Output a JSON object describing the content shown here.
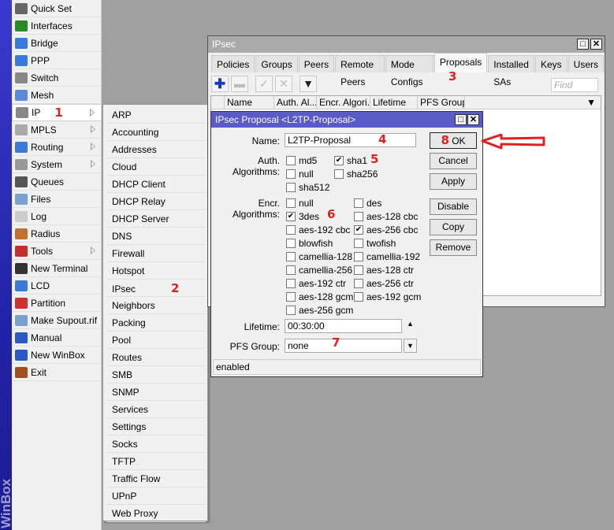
{
  "brand": "WinBox",
  "sidebar": {
    "items": [
      {
        "label": "Quick Set",
        "icon": "quick-set-icon",
        "color": "#666",
        "submenu": false
      },
      {
        "label": "Interfaces",
        "icon": "interfaces-icon",
        "color": "#2a8a2a",
        "submenu": false
      },
      {
        "label": "Bridge",
        "icon": "bridge-icon",
        "color": "#3a7ad8",
        "submenu": false
      },
      {
        "label": "PPP",
        "icon": "ppp-icon",
        "color": "#3a7ad8",
        "submenu": false
      },
      {
        "label": "Switch",
        "icon": "switch-icon",
        "color": "#888",
        "submenu": false
      },
      {
        "label": "Mesh",
        "icon": "mesh-icon",
        "color": "#5a8ad8",
        "submenu": false
      },
      {
        "label": "IP",
        "icon": "ip-icon",
        "color": "#888",
        "submenu": true,
        "active": true,
        "marker": "1"
      },
      {
        "label": "MPLS",
        "icon": "mpls-icon",
        "color": "#aaa",
        "submenu": true
      },
      {
        "label": "Routing",
        "icon": "routing-icon",
        "color": "#3a7ad8",
        "submenu": true
      },
      {
        "label": "System",
        "icon": "system-icon",
        "color": "#999",
        "submenu": true
      },
      {
        "label": "Queues",
        "icon": "queues-icon",
        "color": "#555",
        "submenu": false
      },
      {
        "label": "Files",
        "icon": "files-icon",
        "color": "#7aa0d0",
        "submenu": false
      },
      {
        "label": "Log",
        "icon": "log-icon",
        "color": "#ccc",
        "submenu": false
      },
      {
        "label": "Radius",
        "icon": "radius-icon",
        "color": "#c07030",
        "submenu": false
      },
      {
        "label": "Tools",
        "icon": "tools-icon",
        "color": "#c03030",
        "submenu": true
      },
      {
        "label": "New Terminal",
        "icon": "terminal-icon",
        "color": "#333",
        "submenu": false
      },
      {
        "label": "LCD",
        "icon": "lcd-icon",
        "color": "#3a7ad8",
        "submenu": false
      },
      {
        "label": "Partition",
        "icon": "partition-icon",
        "color": "#d03030",
        "submenu": false
      },
      {
        "label": "Make Supout.rif",
        "icon": "supout-icon",
        "color": "#7aa0d0",
        "submenu": false
      },
      {
        "label": "Manual",
        "icon": "manual-icon",
        "color": "#2a5ac8",
        "submenu": false
      },
      {
        "label": "New WinBox",
        "icon": "winbox-icon",
        "color": "#2a5ac8",
        "submenu": false
      },
      {
        "label": "Exit",
        "icon": "exit-icon",
        "color": "#a05020",
        "submenu": false
      }
    ]
  },
  "ip_submenu": {
    "items": [
      "ARP",
      "Accounting",
      "Addresses",
      "Cloud",
      "DHCP Client",
      "DHCP Relay",
      "DHCP Server",
      "DNS",
      "Firewall",
      "Hotspot",
      "IPsec",
      "Neighbors",
      "Packing",
      "Pool",
      "Routes",
      "SMB",
      "SNMP",
      "Services",
      "Settings",
      "Socks",
      "TFTP",
      "Traffic Flow",
      "UPnP",
      "Web Proxy"
    ],
    "ipsec_marker": "2"
  },
  "ipsec_window": {
    "title": "IPsec",
    "tabs": [
      "Policies",
      "Groups",
      "Peers",
      "Remote Peers",
      "Mode Configs",
      "Proposals",
      "Installed SAs",
      "Keys",
      "Users"
    ],
    "selected_tab": "Proposals",
    "tab_marker": "3",
    "find_placeholder": "Find",
    "columns": [
      "Name",
      "Auth. Al...",
      "Encr. Algori...",
      "Lifetime",
      "PFS Group"
    ]
  },
  "proposal_dialog": {
    "title": "IPsec Proposal <L2TP-Proposal>",
    "name_label": "Name:",
    "name_value": "L2TP-Proposal",
    "name_marker": "4",
    "auth_label": "Auth. Algorithms:",
    "auth_marker": "5",
    "auth": [
      {
        "label": "md5",
        "checked": false
      },
      {
        "label": "sha1",
        "checked": true
      },
      {
        "label": "null",
        "checked": false
      },
      {
        "label": "sha256",
        "checked": false
      },
      {
        "label": "sha512",
        "checked": false
      }
    ],
    "encr_label": "Encr. Algorithms:",
    "encr_marker": "6",
    "encr": [
      {
        "label": "null",
        "checked": false
      },
      {
        "label": "des",
        "checked": false
      },
      {
        "label": "3des",
        "checked": true
      },
      {
        "label": "aes-128 cbc",
        "checked": false
      },
      {
        "label": "aes-192 cbc",
        "checked": false
      },
      {
        "label": "aes-256 cbc",
        "checked": true
      },
      {
        "label": "blowfish",
        "checked": false
      },
      {
        "label": "twofish",
        "checked": false
      },
      {
        "label": "camellia-128",
        "checked": false
      },
      {
        "label": "camellia-192",
        "checked": false
      },
      {
        "label": "camellia-256",
        "checked": false
      },
      {
        "label": "aes-128 ctr",
        "checked": false
      },
      {
        "label": "aes-192 ctr",
        "checked": false
      },
      {
        "label": "aes-256 ctr",
        "checked": false
      },
      {
        "label": "aes-128 gcm",
        "checked": false
      },
      {
        "label": "aes-192 gcm",
        "checked": false
      },
      {
        "label": "aes-256 gcm",
        "checked": false
      }
    ],
    "lifetime_label": "Lifetime:",
    "lifetime_value": "00:30:00",
    "pfs_label": "PFS Group:",
    "pfs_value": "none",
    "pfs_marker": "7",
    "buttons": {
      "ok": "OK",
      "ok_marker": "8",
      "cancel": "Cancel",
      "apply": "Apply",
      "disable": "Disable",
      "copy": "Copy",
      "remove": "Remove"
    },
    "status": "enabled"
  },
  "colors": {
    "accent_red": "#e02020",
    "dialog_title": "#5a5ac8",
    "brand_bar": "#2323a8"
  }
}
